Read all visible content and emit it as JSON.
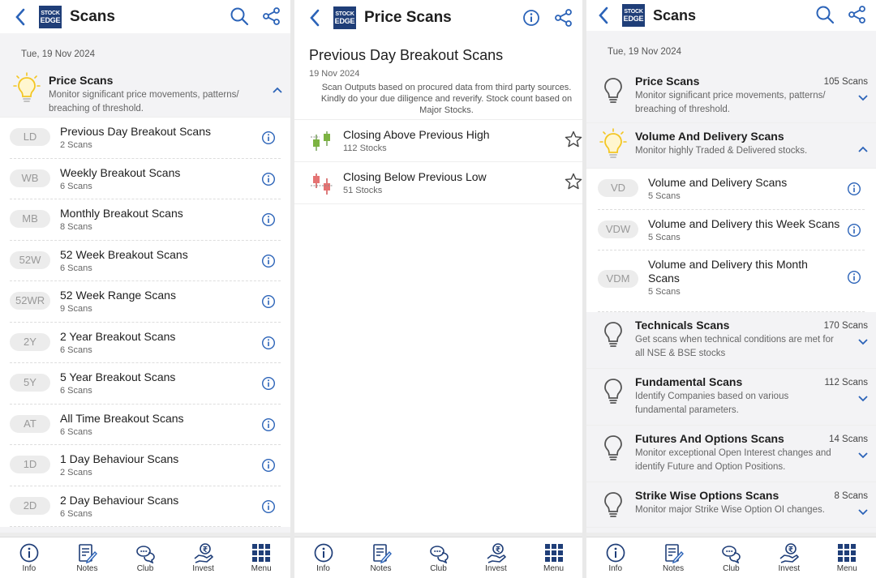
{
  "screen1": {
    "title": "Scans",
    "date": "Tue, 19 Nov 2024",
    "category": {
      "title": "Price Scans",
      "desc": "Monitor significant price movements, patterns/ breaching of threshold."
    },
    "items": [
      {
        "badge": "LD",
        "title": "Previous Day Breakout Scans",
        "sub": "2 Scans"
      },
      {
        "badge": "WB",
        "title": "Weekly Breakout Scans",
        "sub": "6 Scans"
      },
      {
        "badge": "MB",
        "title": "Monthly Breakout Scans",
        "sub": "8 Scans"
      },
      {
        "badge": "52W",
        "title": "52 Week Breakout Scans",
        "sub": "6 Scans"
      },
      {
        "badge": "52WR",
        "title": "52 Week Range Scans",
        "sub": "9 Scans"
      },
      {
        "badge": "2Y",
        "title": "2 Year Breakout Scans",
        "sub": "6 Scans"
      },
      {
        "badge": "5Y",
        "title": "5 Year Breakout Scans",
        "sub": "6 Scans"
      },
      {
        "badge": "AT",
        "title": "All Time Breakout Scans",
        "sub": "6 Scans"
      },
      {
        "badge": "1D",
        "title": "1 Day Behaviour Scans",
        "sub": "2 Scans"
      },
      {
        "badge": "2D",
        "title": "2 Day Behaviour Scans",
        "sub": "6 Scans"
      }
    ]
  },
  "screen2": {
    "title": "Price Scans",
    "heading": "Previous Day Breakout Scans",
    "date": "19 Nov 2024",
    "note": "Scan Outputs based on procured data from third party sources. Kindly do your due diligence and reverify. Stock count based on Major Stocks.",
    "scans": [
      {
        "title": "Closing Above Previous High",
        "sub": "112 Stocks"
      },
      {
        "title": "Closing Below Previous Low",
        "sub": "51 Stocks"
      }
    ]
  },
  "screen3": {
    "title": "Scans",
    "date": "Tue, 19 Nov 2024",
    "price": {
      "title": "Price Scans",
      "desc": "Monitor significant price movements, patterns/ breaching of threshold.",
      "count": "105 Scans"
    },
    "volume": {
      "title": "Volume And Delivery Scans",
      "desc": "Monitor highly Traded & Delivered stocks."
    },
    "volume_items": [
      {
        "badge": "VD",
        "title": "Volume and Delivery Scans",
        "sub": "5 Scans"
      },
      {
        "badge": "VDW",
        "title": "Volume and Delivery this Week Scans",
        "sub": "5 Scans"
      },
      {
        "badge": "VDM",
        "title": "Volume and Delivery this Month Scans",
        "sub": "5 Scans"
      }
    ],
    "technicals": {
      "title": "Technicals Scans",
      "desc": "Get scans when technical conditions are met for all NSE & BSE stocks",
      "count": "170 Scans"
    },
    "fundamental": {
      "title": "Fundamental Scans",
      "desc": "Identify Companies based on various fundamental parameters.",
      "count": "112 Scans"
    },
    "fno": {
      "title": "Futures And Options Scans",
      "desc": "Monitor exceptional Open Interest changes and identify Future and Option Positions.",
      "count": "14 Scans"
    },
    "strike": {
      "title": "Strike Wise Options Scans",
      "desc": "Monitor major Strike Wise Option OI changes.",
      "count": "8 Scans"
    }
  },
  "logo": {
    "line1": "STOCK",
    "line2": "EDGE"
  },
  "nav": [
    {
      "label": "Info",
      "icon": "info-circle-icon"
    },
    {
      "label": "Notes",
      "icon": "notes-icon"
    },
    {
      "label": "Club",
      "icon": "chat-bubbles-icon"
    },
    {
      "label": "Invest",
      "icon": "rupee-hand-icon"
    },
    {
      "label": "Menu",
      "icon": "grid-menu-icon"
    }
  ],
  "colors": {
    "brand": "#1f3e78",
    "accent": "#2b63b8",
    "bulb_active": "#f3c623",
    "bull_green": "#7cb342",
    "bear_red": "#e57373"
  }
}
